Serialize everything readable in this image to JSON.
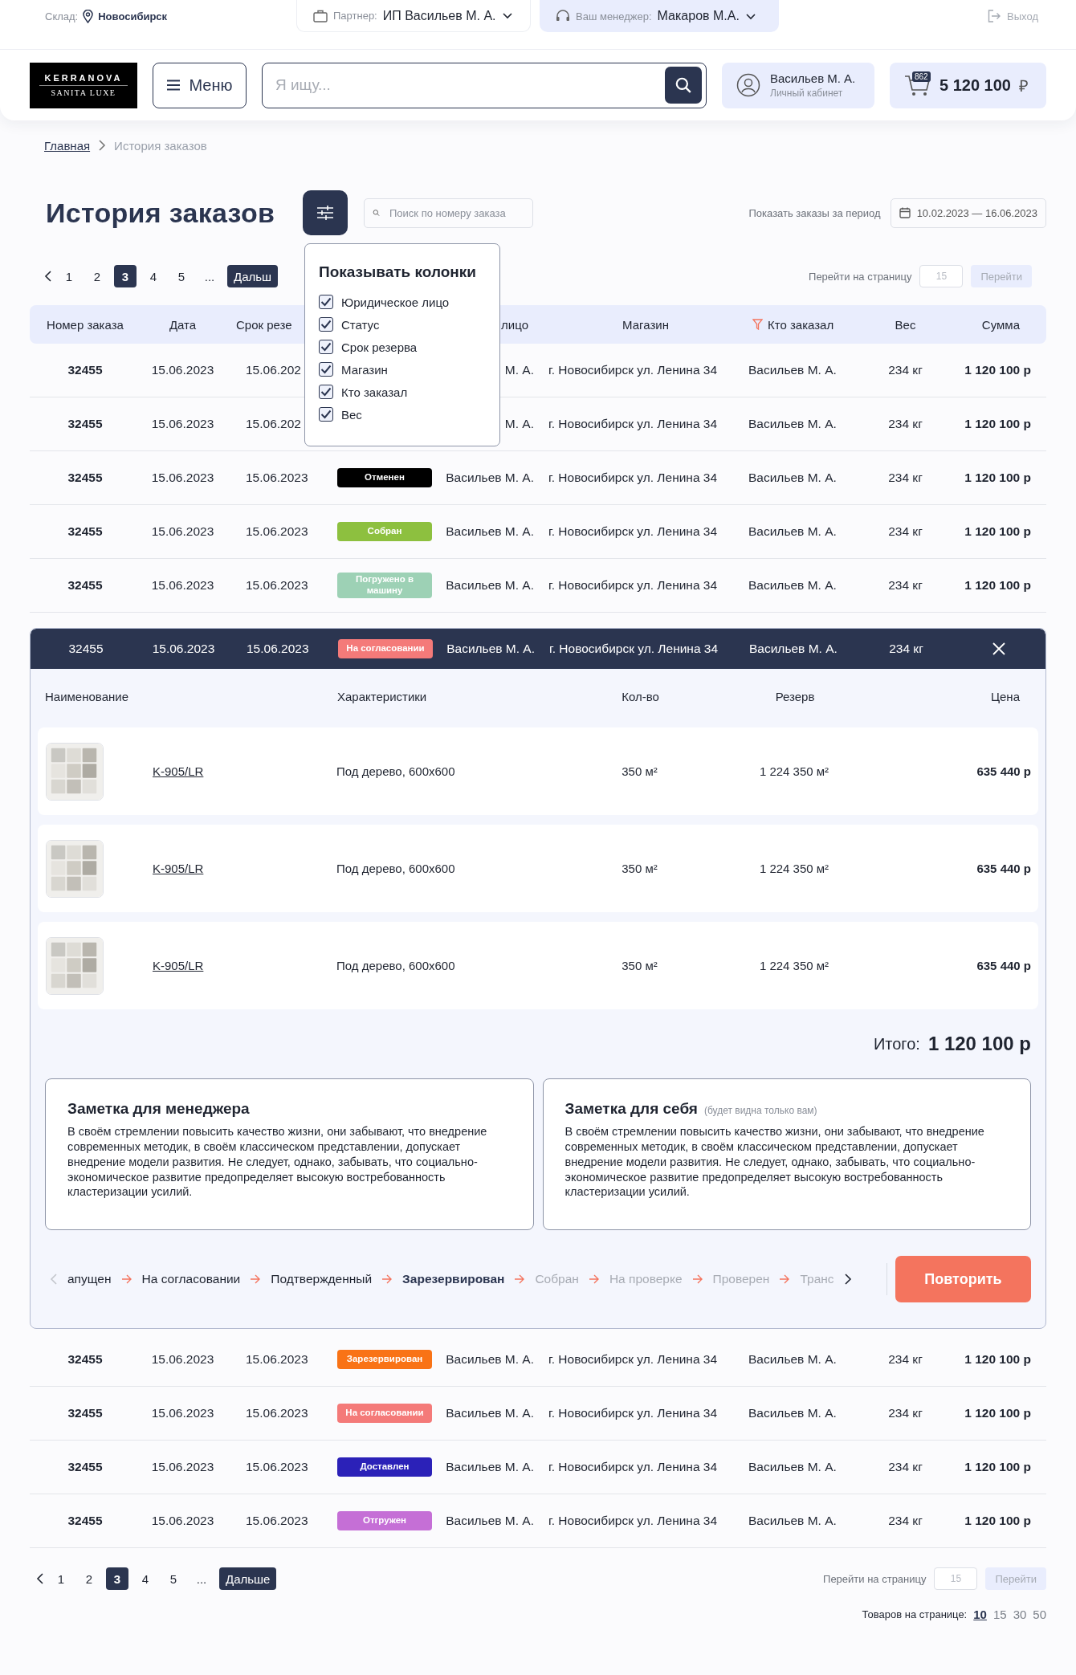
{
  "topbar": {
    "warehouse_label": "Склад:",
    "warehouse": "Новосибирск",
    "partner_label": "Партнер:",
    "partner": "ИП Васильев М. А.",
    "manager_label": "Ваш менеджер:",
    "manager": "Макаров М.А.",
    "logout": "Выход"
  },
  "header": {
    "logo_top": "KERRANOVA",
    "logo_bottom": "SANITA LUXE",
    "menu": "Меню",
    "search_placeholder": "Я ищу...",
    "user_name": "Васильев М. А.",
    "user_sub": "Личный кабинет",
    "cart_count": "862",
    "cart_total": "5 120 100",
    "currency": "₽"
  },
  "breadcrumbs": [
    {
      "label": "Главная",
      "link": true
    },
    {
      "label": "История заказов",
      "link": false
    }
  ],
  "page_title": "История заказов",
  "order_search": {
    "placeholder": "Поиск по номеру заказа"
  },
  "period": {
    "label": "Показать заказы за период",
    "value": "10.02.2023 — 16.06.2023"
  },
  "column_menu": {
    "title": "Показывать колонки",
    "options": [
      {
        "label": "Юридическое лицо",
        "checked": true
      },
      {
        "label": "Статус",
        "checked": true
      },
      {
        "label": "Срок резерва",
        "checked": true
      },
      {
        "label": "Магазин",
        "checked": true
      },
      {
        "label": "Кто заказал",
        "checked": true
      },
      {
        "label": "Вес",
        "checked": true
      }
    ]
  },
  "pagination_top": {
    "pages": [
      {
        "label": "1",
        "selected": false
      },
      {
        "label": "2",
        "selected": false
      },
      {
        "label": "3",
        "selected": true
      },
      {
        "label": "4",
        "selected": false
      },
      {
        "label": "5",
        "selected": false
      },
      {
        "label": "...",
        "selected": false
      }
    ],
    "next": "Дальш",
    "goto_label": "Перейти на страницу",
    "goto_placeholder": "15",
    "goto_button": "Перейти"
  },
  "table": {
    "columns": [
      {
        "label": "Номер заказа",
        "filtered": false
      },
      {
        "label": "Дата",
        "filtered": false
      },
      {
        "label": "Срок резе",
        "filtered": false
      },
      {
        "label": "лицо",
        "filtered": false
      },
      {
        "label": "Магазин",
        "filtered": false
      },
      {
        "label": "Кто заказал",
        "filtered": true
      },
      {
        "label": "Вес",
        "filtered": false
      },
      {
        "label": "Сумма",
        "filtered": false
      }
    ],
    "rows": [
      {
        "number": "32455",
        "date": "15.06.2023",
        "reserve_until": "15.06.202",
        "legal": "М. А.",
        "store": "г. Новосибирск ул. Ленина 34",
        "ordered_by": "Васильев М. А.",
        "weight": "234 кг",
        "sum": "1 120 100 р"
      },
      {
        "number": "32455",
        "date": "15.06.2023",
        "reserve_until": "15.06.202",
        "legal": "М. А.",
        "store": "г. Новосибирск ул. Ленина 34",
        "ordered_by": "Васильев М. А.",
        "weight": "234 кг",
        "sum": "1 120 100 р"
      },
      {
        "number": "32455",
        "date": "15.06.2023",
        "reserve_until": "15.06.2023",
        "status": {
          "label": "Отменен",
          "color": "#000000"
        },
        "legal": "Васильев М. А.",
        "store": "г. Новосибирск ул. Ленина 34",
        "ordered_by": "Васильев М. А.",
        "weight": "234 кг",
        "sum": "1 120 100 р"
      },
      {
        "number": "32455",
        "date": "15.06.2023",
        "reserve_until": "15.06.2023",
        "status": {
          "label": "Собран",
          "color": "#8dc03f"
        },
        "legal": "Васильев М. А.",
        "store": "г. Новосибирск ул. Ленина 34",
        "ordered_by": "Васильев М. А.",
        "weight": "234 кг",
        "sum": "1 120 100 р"
      },
      {
        "number": "32455",
        "date": "15.06.2023",
        "reserve_until": "15.06.2023",
        "status": {
          "label": "Погружено в машину",
          "color": "#9dd1b5"
        },
        "legal": "Васильев М. А.",
        "store": "г. Новосибирск ул. Ленина 34",
        "ordered_by": "Васильев М. А.",
        "weight": "234 кг",
        "sum": "1 120 100 р"
      },
      {
        "number": "32455",
        "date": "15.06.2023",
        "reserve_until": "15.06.2023",
        "status": {
          "label": "На согласовании",
          "color": "#f47a79"
        },
        "legal": "Васильев М. А.",
        "store": "г. Новосибирск ул. Ленина 34",
        "ordered_by": "Васильев М. А.",
        "weight": "234 кг",
        "details": {
          "columns": [
            "Наименование",
            "Характеристики",
            "Кол-во",
            "Резерв",
            "Цена"
          ],
          "items": [
            {
              "kind": "picture",
              "sku": "K-905/LR",
              "spec": "Под дерево, 600x600",
              "qty": "350 м²",
              "reserve": "1 224 350 м²",
              "price": "635 440 р"
            },
            {
              "kind": "picture",
              "sku": "K-905/LR",
              "spec": "Под дерево, 600x600",
              "qty": "350 м²",
              "reserve": "1 224 350 м²",
              "price": "635 440 р"
            },
            {
              "kind": "picture",
              "sku": "K-905/LR",
              "spec": "Под дерево, 600x600",
              "qty": "350 м²",
              "reserve": "1 224 350 м²",
              "price": "635 440 р"
            }
          ],
          "total_label": "Итого:",
          "total": "1 120 100 р",
          "notes": [
            {
              "title": "Заметка для менеджера",
              "text": "В своём стремлении повысить качество жизни, они забывают, что внедрение современных методик, в своём классическом представлении, допускает внедрение модели развития. Не следует, однако, забывать, что социально-экономическое развитие предопределяет высокую востребованность кластеризации усилий."
            },
            {
              "title": "Заметка для себя",
              "hint": "(будет видна только вам)",
              "text": "В своём стремлении повысить качество жизни, они забывают, что внедрение современных методик, в своём классическом представлении, допускает внедрение модели развития. Не следует, однако, забывать, что социально-экономическое развитие предопределяет высокую востребованность кластеризации усилий."
            }
          ],
          "steps": [
            {
              "label": "апущен",
              "completed": true,
              "selected": false
            },
            {
              "label": "На согласовании",
              "completed": true,
              "selected": false
            },
            {
              "label": "Подтвержденный",
              "completed": true,
              "selected": false
            },
            {
              "label": "Зарезервирован",
              "completed": false,
              "selected": true
            },
            {
              "label": "Собран",
              "completed": false,
              "selected": false
            },
            {
              "label": "На проверке",
              "completed": false,
              "selected": false
            },
            {
              "label": "Проверен",
              "completed": false,
              "selected": false
            },
            {
              "label": "Транс",
              "completed": false,
              "selected": false
            }
          ],
          "repeat": "Повторить"
        }
      },
      {
        "number": "32455",
        "date": "15.06.2023",
        "reserve_until": "15.06.2023",
        "status": {
          "label": "Зарезервирован",
          "color": "#f97316"
        },
        "legal": "Васильев М. А.",
        "store": "г. Новосибирск ул. Ленина 34",
        "ordered_by": "Васильев М. А.",
        "weight": "234 кг",
        "sum": "1 120 100 р"
      },
      {
        "number": "32455",
        "date": "15.06.2023",
        "reserve_until": "15.06.2023",
        "status": {
          "label": "На согласовании",
          "color": "#f47a79"
        },
        "legal": "Васильев М. А.",
        "store": "г. Новосибирск ул. Ленина 34",
        "ordered_by": "Васильев М. А.",
        "weight": "234 кг",
        "sum": "1 120 100 р"
      },
      {
        "number": "32455",
        "date": "15.06.2023",
        "reserve_until": "15.06.2023",
        "status": {
          "label": "Доставлен",
          "color": "#2b21b8"
        },
        "legal": "Васильев М. А.",
        "store": "г. Новосибирск ул. Ленина 34",
        "ordered_by": "Васильев М. А.",
        "weight": "234 кг",
        "sum": "1 120 100 р"
      },
      {
        "number": "32455",
        "date": "15.06.2023",
        "reserve_until": "15.06.2023",
        "status": {
          "label": "Отгружен",
          "color": "#c56fd6"
        },
        "legal": "Васильев М. А.",
        "store": "г. Новосибирск ул. Ленина 34",
        "ordered_by": "Васильев М. А.",
        "weight": "234 кг",
        "sum": "1 120 100 р"
      }
    ]
  },
  "pagination_bottom": {
    "pages": [
      {
        "label": "1",
        "selected": false
      },
      {
        "label": "2",
        "selected": false
      },
      {
        "label": "3",
        "selected": true
      },
      {
        "label": "4",
        "selected": false
      },
      {
        "label": "5",
        "selected": false
      },
      {
        "label": "...",
        "selected": false
      }
    ],
    "next": "Дальше",
    "goto_label": "Перейти на страницу",
    "goto_placeholder": "15",
    "goto_button": "Перейти"
  },
  "per_page": {
    "label": "Товаров на странице:",
    "options": [
      {
        "label": "10",
        "selected": true
      },
      {
        "label": "15",
        "selected": false
      },
      {
        "label": "30",
        "selected": false
      },
      {
        "label": "50",
        "selected": false
      }
    ]
  }
}
